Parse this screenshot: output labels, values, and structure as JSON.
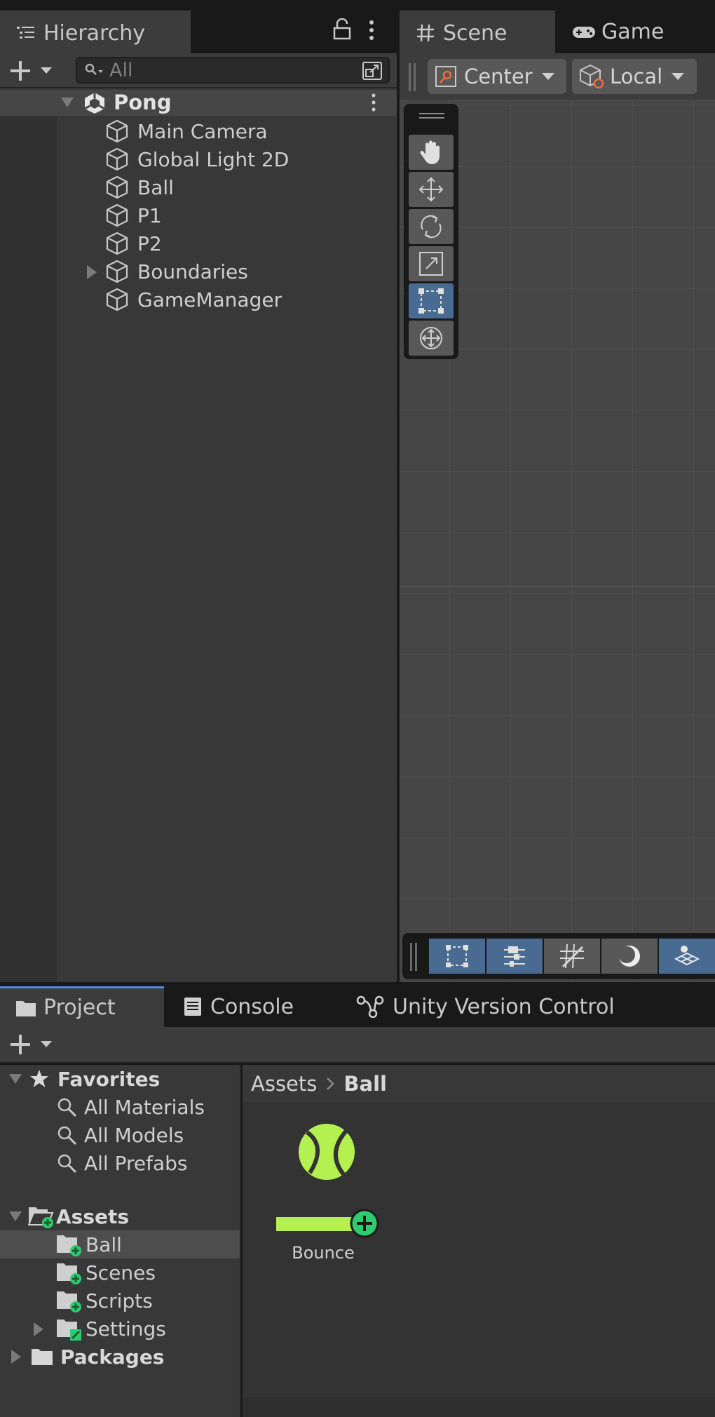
{
  "top_tabs": {
    "hierarchy": "Hierarchy",
    "scene": "Scene",
    "game": "Game"
  },
  "hierarchy": {
    "search_placeholder": "All",
    "scene_name": "Pong",
    "objects": [
      {
        "label": "Main Camera"
      },
      {
        "label": "Global Light 2D"
      },
      {
        "label": "Ball"
      },
      {
        "label": "P1"
      },
      {
        "label": "P2"
      },
      {
        "label": "Boundaries",
        "collapsed_children": true
      },
      {
        "label": "GameManager"
      }
    ]
  },
  "scene_toolbar": {
    "pivot_mode": "Center",
    "pivot_rotation": "Local"
  },
  "tools": [
    "hand-tool",
    "move-tool",
    "rotate-tool",
    "scale-tool",
    "rect-tool",
    "transform-tool"
  ],
  "selected_tool": "rect-tool",
  "bottom_tabs": {
    "project": "Project",
    "console": "Console",
    "version_control": "Unity Version Control"
  },
  "project": {
    "favorites_label": "Favorites",
    "favorites": [
      "All Materials",
      "All Models",
      "All Prefabs"
    ],
    "assets_label": "Assets",
    "asset_folders": [
      {
        "label": "Ball",
        "selected": true
      },
      {
        "label": "Scenes"
      },
      {
        "label": "Scripts"
      },
      {
        "label": "Settings"
      }
    ],
    "packages_label": "Packages",
    "breadcrumb": [
      "Assets",
      "Ball"
    ],
    "items": [
      {
        "label": "Bounce"
      }
    ]
  },
  "colors": {
    "accent_selected": "#4a6b91",
    "tab_highlight": "#4d8ae0",
    "asset_green": "#b4f050",
    "badge_green": "#2ecc71"
  }
}
